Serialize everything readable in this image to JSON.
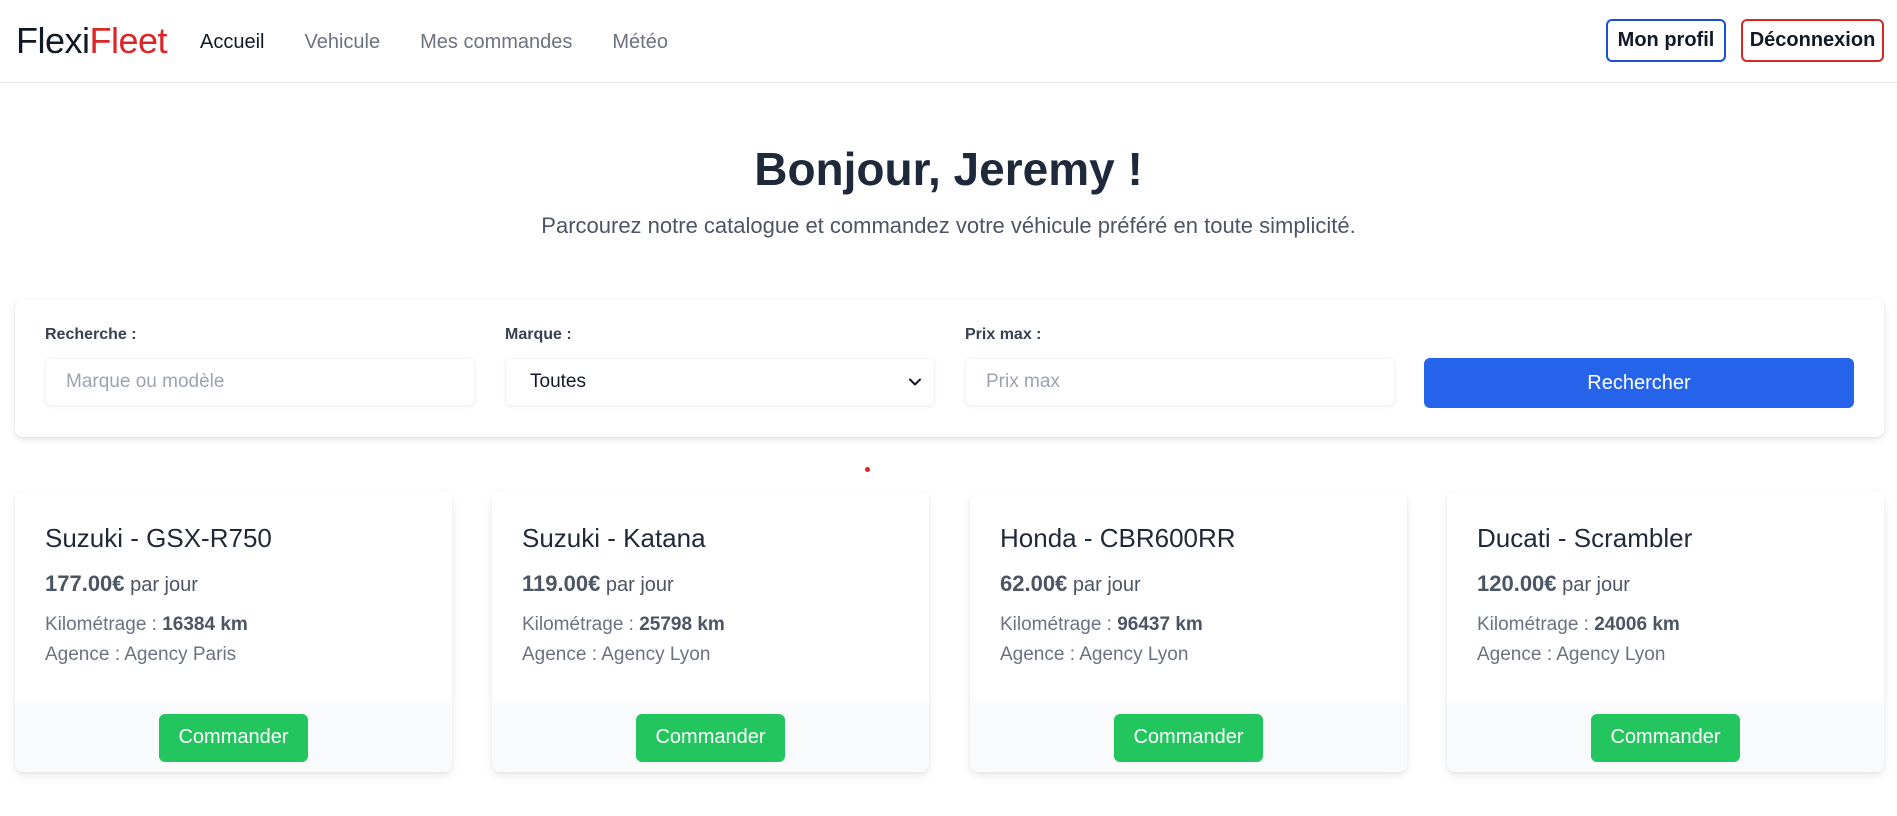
{
  "brand": {
    "part1": "Flexi",
    "part2": "Fleet",
    "color_primary": "#111827",
    "color_accent": "#dc2626"
  },
  "nav": {
    "links": [
      {
        "label": "Accueil",
        "active": true
      },
      {
        "label": "Vehicule",
        "active": false
      },
      {
        "label": "Mes commandes",
        "active": false
      },
      {
        "label": "Météo",
        "active": false
      }
    ],
    "profile_label": "Mon profil",
    "logout_label": "Déconnexion"
  },
  "hero": {
    "title": "Bonjour, Jeremy !",
    "subtitle": "Parcourez notre catalogue et commandez votre véhicule préféré en toute simplicité."
  },
  "search": {
    "query_label": "Recherche :",
    "query_placeholder": "Marque ou modèle",
    "query_value": "",
    "brand_label": "Marque :",
    "brand_selected": "Toutes",
    "price_label": "Prix max :",
    "price_placeholder": "Prix max",
    "price_value": "",
    "submit_label": "Rechercher",
    "submit_color": "#2563eb"
  },
  "vehicles": [
    {
      "title": "Suzuki - GSX-R750",
      "price": "177.00€",
      "price_unit": "par jour",
      "km_label": "Kilométrage :",
      "km": "16384 km",
      "agency_label": "Agence :",
      "agency": "Agency Paris",
      "order_label": "Commander"
    },
    {
      "title": "Suzuki - Katana",
      "price": "119.00€",
      "price_unit": "par jour",
      "km_label": "Kilométrage :",
      "km": "25798 km",
      "agency_label": "Agence :",
      "agency": "Agency Lyon",
      "order_label": "Commander"
    },
    {
      "title": "Honda - CBR600RR",
      "price": "62.00€",
      "price_unit": "par jour",
      "km_label": "Kilométrage :",
      "km": "96437 km",
      "agency_label": "Agence :",
      "agency": "Agency Lyon",
      "order_label": "Commander"
    },
    {
      "title": "Ducati - Scrambler",
      "price": "120.00€",
      "price_unit": "par jour",
      "km_label": "Kilométrage :",
      "km": "24006 km",
      "agency_label": "Agence :",
      "agency": "Agency Lyon",
      "order_label": "Commander"
    }
  ],
  "colors": {
    "order_button": "#22c55e",
    "profile_border": "#1d4ed8",
    "logout_border": "#dc2626"
  },
  "icons": {
    "select_chevron": "chevron-down-icon"
  }
}
